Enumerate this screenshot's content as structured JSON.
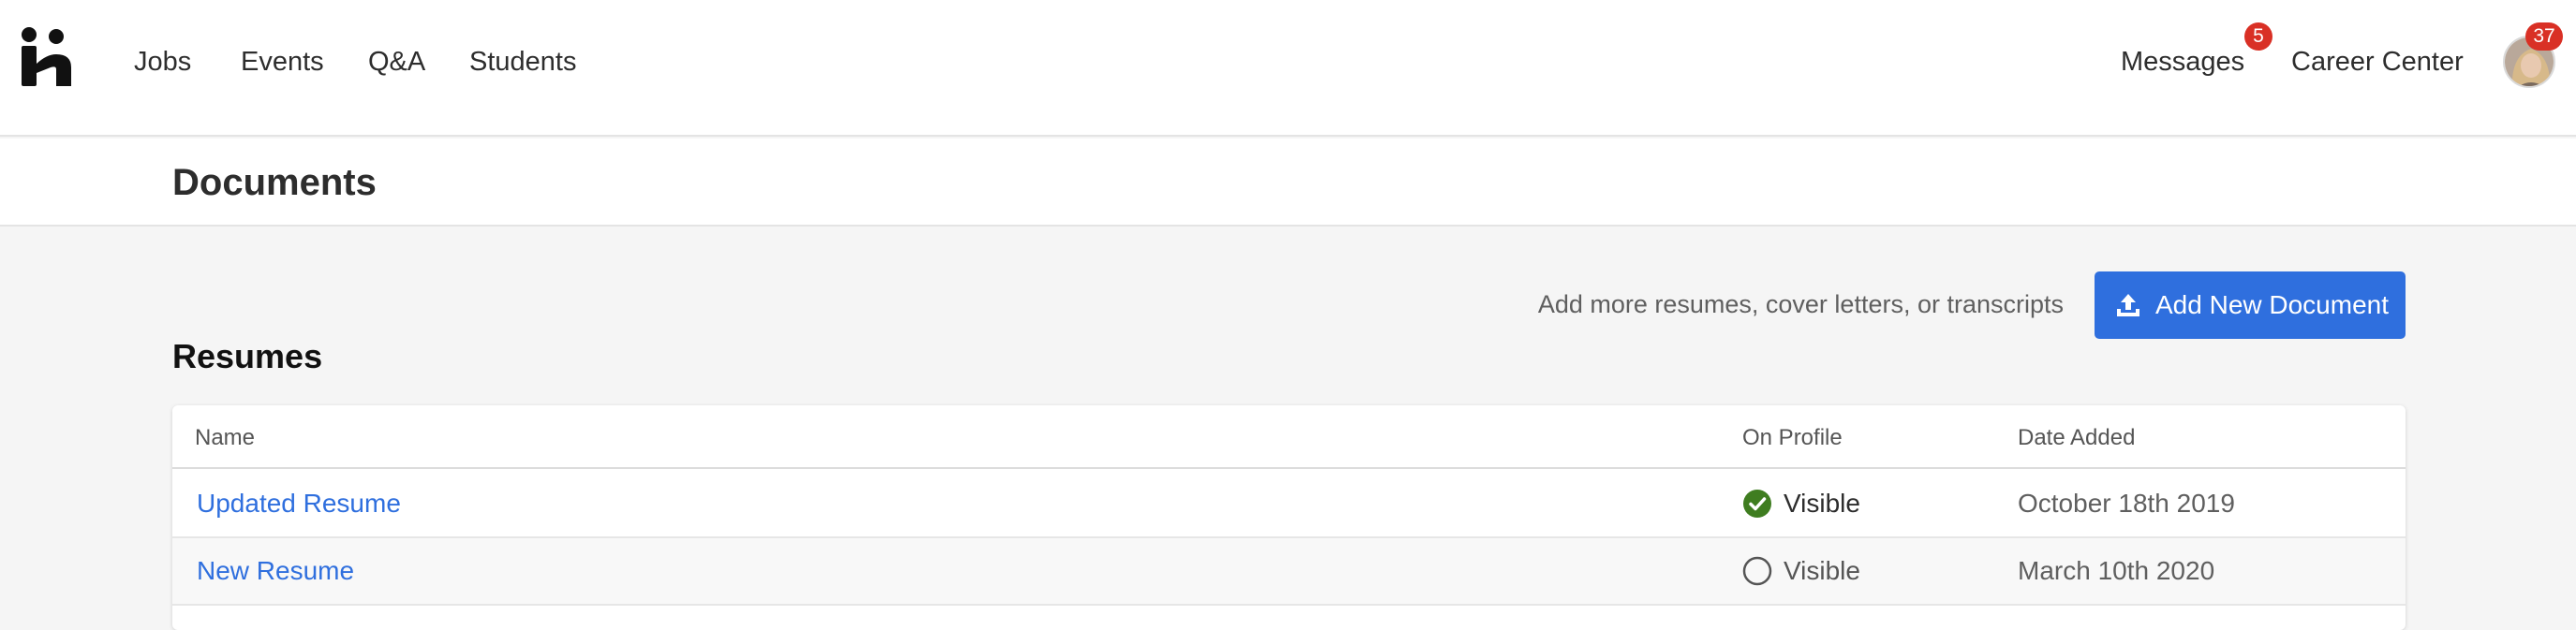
{
  "nav": {
    "links": [
      "Jobs",
      "Events",
      "Q&A",
      "Students"
    ],
    "messages_label": "Messages",
    "messages_badge": "5",
    "career_center_label": "Career Center",
    "avatar_badge": "37"
  },
  "page": {
    "title": "Documents"
  },
  "actions": {
    "hint": "Add more resumes, cover letters, or transcripts",
    "add_button_label": "Add New Document"
  },
  "resumes": {
    "section_title": "Resumes",
    "columns": [
      "Name",
      "On Profile",
      "Date Added"
    ],
    "rows": [
      {
        "name": "Updated Resume",
        "on_profile": "Visible",
        "visible_checked": true,
        "date_added": "October 18th 2019"
      },
      {
        "name": "New Resume",
        "on_profile": "Visible",
        "visible_checked": false,
        "date_added": "March 10th 2020"
      }
    ]
  },
  "colors": {
    "accent": "#2f6fde",
    "badge": "#d93025",
    "check_green": "#3f7d20"
  },
  "icons": [
    "handshake-logo-icon",
    "upload-icon",
    "check-circle-icon",
    "empty-circle-icon"
  ]
}
